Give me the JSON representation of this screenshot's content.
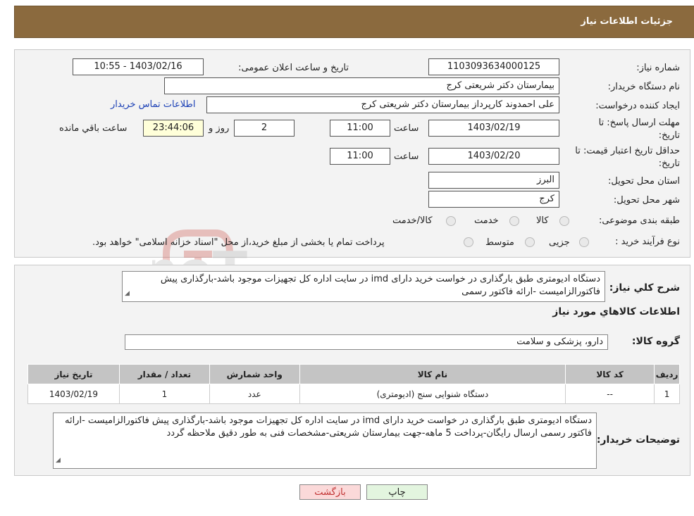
{
  "header": {
    "title": "جزئیات اطلاعات نیاز"
  },
  "form": {
    "need_number_label": "شماره نیاز:",
    "need_number": "1103093634000125",
    "announce_label": "تاریخ و ساعت اعلان عمومی:",
    "announce_value": "1403/02/16 - 10:55",
    "buyer_org_label": "نام دستگاه خریدار:",
    "buyer_org": "بیمارستان دکتر شریعتی کرج",
    "requester_label": "ایجاد کننده درخواست:",
    "requester": "علی احمدوند کارپرداز بیمارستان دکتر شریعتی کرج",
    "contact_link": "اطلاعات تماس خریدار",
    "deadline_label_1": "مهلت ارسال پاسخ: تا",
    "deadline_label_2": "تاریخ:",
    "deadline_date": "1403/02/19",
    "time_label": "ساعت",
    "deadline_time": "11:00",
    "days_value": "2",
    "days_label": "روز و",
    "remaining_time": "23:44:06",
    "remaining_label": "ساعت باقي مانده",
    "validity_label_1": "حداقل تاریخ اعتبار قیمت: تا",
    "validity_label_2": "تاریخ:",
    "validity_date": "1403/02/20",
    "validity_time": "11:00",
    "province_label": "استان محل تحویل:",
    "province": "البرز",
    "city_label": "شهر محل تحویل:",
    "city": "کرج",
    "category_label": "طبقه بندی موضوعی:",
    "category_options": [
      "کالا",
      "خدمت",
      "کالا/خدمت"
    ],
    "process_label": "نوع فرآیند خرید :",
    "process_options": [
      "جزیی",
      "متوسط"
    ],
    "process_note": "پرداخت تمام یا بخشی از مبلغ خرید،از محل \"اسناد خزانه اسلامی\" خواهد بود."
  },
  "details": {
    "summary_label": "شرح کلي نياز:",
    "summary_text": "دستگاه ادیومتری  طبق بارگذاری در خواست خرید دارای imd در سایت اداره کل تجهیزات موجود باشد-بارگذاری پیش فاکتورالزامیست -ارائه فاکتور رسمی",
    "goods_info_title": "اطلاعات کالاهاي مورد نياز",
    "goods_group_label": "گروه کالا:",
    "goods_group": "دارو، پزشکی و سلامت",
    "table_headers": [
      "رديف",
      "کد کالا",
      "نام کالا",
      "واحد شمارش",
      "تعداد / مقدار",
      "تاریخ نیاز"
    ],
    "table_rows": [
      [
        "1",
        "--",
        "دستگاه شنوایی سنج (ادیومتری)",
        "عدد",
        "1",
        "1403/02/19"
      ]
    ],
    "buyer_notes_label": "توضیحات خریدار:",
    "buyer_notes": "دستگاه ادیومتری طبق بارگذاری در خواست خرید دارای imd در سایت اداره کل تجهیزات موجود باشد-بارگذاری پیش فاکتورالزامیست -ارائه فاکتور رسمی ارسال رایگان-پرداخت 5 ماهه-جهت بیمارستان شریعتی-مشخصات فنی به طور دقیق ملاحظه گردد"
  },
  "buttons": {
    "print": "چاپ",
    "back": "بازگشت"
  },
  "watermark": {
    "text": "AriaTender.neT"
  }
}
